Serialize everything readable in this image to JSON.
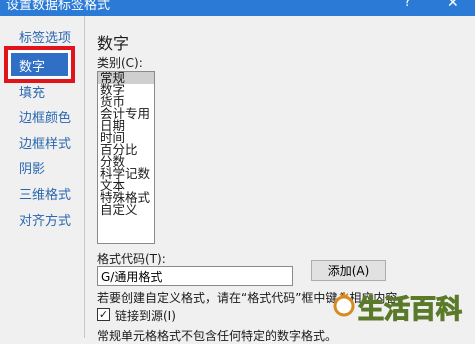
{
  "window": {
    "title": "设置数据标签格式",
    "help_glyph": "?",
    "close_glyph": "✕"
  },
  "nav": {
    "items": [
      {
        "label": "标签选项"
      },
      {
        "label": "数字",
        "selected": true
      },
      {
        "label": "填充"
      },
      {
        "label": "边框颜色"
      },
      {
        "label": "边框样式"
      },
      {
        "label": "阴影"
      },
      {
        "label": "三维格式"
      },
      {
        "label": "对齐方式"
      }
    ],
    "highlight_color": "#e0141a",
    "selected_bg": "#2f6fc5"
  },
  "panel": {
    "title": "数字",
    "category_label": "类别(C):",
    "categories": [
      "常规",
      "数字",
      "货币",
      "会计专用",
      "日期",
      "时间",
      "百分比",
      "分数",
      "科学记数",
      "文本",
      "特殊格式",
      "自定义"
    ],
    "selected_category": "常规",
    "format_code_label": "格式代码(T):",
    "format_code_value": "G/通用格式",
    "add_button_label": "添加(A)",
    "hint": "若要创建自定义格式，请在“格式代码”框中键入相应内容。",
    "link_checkbox": {
      "checked": true,
      "label": "链接到源(I)"
    },
    "description": "常规单元格格式不包含任何特定的数字格式。"
  },
  "watermark": {
    "text": "生活百科"
  }
}
